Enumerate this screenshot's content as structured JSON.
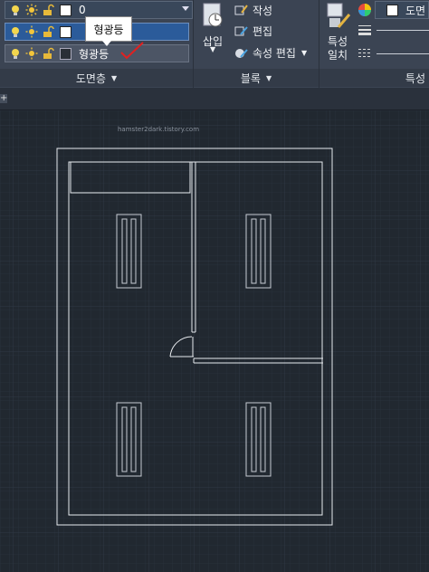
{
  "layers_panel": {
    "current_layer": "0",
    "rows": [
      {
        "name": "",
        "swatch": "white"
      },
      {
        "name": "형광등",
        "swatch": "dark"
      }
    ],
    "footer_label": "도면층",
    "tooltip": "형광등"
  },
  "block_panel": {
    "insert_label_line1": "삽입",
    "create_label": "작성",
    "edit_label": "편집",
    "attr_edit_label": "속성 편집",
    "footer_label": "블록"
  },
  "properties_panel": {
    "match_label_line1": "특성",
    "match_label_line2": "일치",
    "color_label": "도면",
    "footer_label": "특성"
  },
  "canvas": {
    "watermark": "hamster2dark.tistory.com"
  },
  "colors": {
    "ribbon_bg": "#3b4453",
    "canvas_bg": "#212830",
    "grid": "#2d3640",
    "selected_row": "#2b5b9a",
    "annotation_red": "#e02020"
  }
}
